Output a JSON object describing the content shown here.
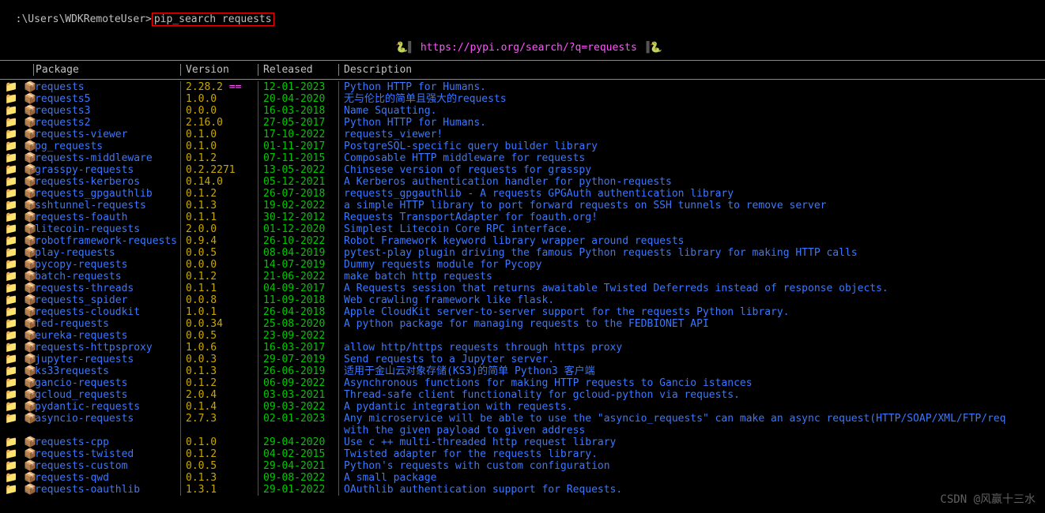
{
  "prompt": {
    "path": ":\\Users\\WDKRemoteUser>",
    "command": "pip_search requests"
  },
  "url_line": {
    "left": "🐍▌",
    "url": "https://pypi.org/search/?q=requests",
    "right": "▐🐍"
  },
  "headers": {
    "package": "Package",
    "version": "Version",
    "released": "Released",
    "description": "Description"
  },
  "rows": [
    {
      "pkg": "requests",
      "ver": "2.28.2 ==",
      "rel": "12-01-2023",
      "desc": "Python HTTP for Humans."
    },
    {
      "pkg": "requests5",
      "ver": "1.0.0",
      "rel": "20-04-2020",
      "desc": "无与伦比的简单且强大的requests"
    },
    {
      "pkg": "requests3",
      "ver": "0.0.0",
      "rel": "16-03-2018",
      "desc": "Name Squatting."
    },
    {
      "pkg": "requests2",
      "ver": "2.16.0",
      "rel": "27-05-2017",
      "desc": "Python HTTP for Humans."
    },
    {
      "pkg": "requests-viewer",
      "ver": "0.1.0",
      "rel": "17-10-2022",
      "desc": "requests_viewer!"
    },
    {
      "pkg": "pg_requests",
      "ver": "0.1.0",
      "rel": "01-11-2017",
      "desc": "PostgreSQL-specific query builder library"
    },
    {
      "pkg": "requests-middleware",
      "ver": "0.1.2",
      "rel": "07-11-2015",
      "desc": "Composable HTTP middleware for requests"
    },
    {
      "pkg": "grasspy-requests",
      "ver": "0.2.2271",
      "rel": "13-05-2022",
      "desc": "Chinsese version of requests for grasspy"
    },
    {
      "pkg": "requests-kerberos",
      "ver": "0.14.0",
      "rel": "05-12-2021",
      "desc": "A Kerberos authentication handler for python-requests"
    },
    {
      "pkg": "requests_gpgauthlib",
      "ver": "0.1.2",
      "rel": "26-07-2018",
      "desc": "requests_gpgauthlib - A requests GPGAuth authentication library"
    },
    {
      "pkg": "sshtunnel-requests",
      "ver": "0.1.3",
      "rel": "19-02-2022",
      "desc": "a simple HTTP library to port forward requests on SSH tunnels to remove server"
    },
    {
      "pkg": "requests-foauth",
      "ver": "0.1.1",
      "rel": "30-12-2012",
      "desc": "Requests TransportAdapter for foauth.org!"
    },
    {
      "pkg": "litecoin-requests",
      "ver": "2.0.0",
      "rel": "01-12-2020",
      "desc": "Simplest Litecoin Core RPC interface."
    },
    {
      "pkg": "robotframework-requests",
      "ver": "0.9.4",
      "rel": "26-10-2022",
      "desc": "Robot Framework keyword library wrapper around requests"
    },
    {
      "pkg": "play-requests",
      "ver": "0.0.5",
      "rel": "08-04-2019",
      "desc": "pytest-play plugin driving the famous Python requests library for making HTTP calls"
    },
    {
      "pkg": "pycopy-requests",
      "ver": "0.0.0",
      "rel": "14-07-2019",
      "desc": "Dummy requests module for Pycopy"
    },
    {
      "pkg": "batch-requests",
      "ver": "0.1.2",
      "rel": "21-06-2022",
      "desc": "make batch http requests"
    },
    {
      "pkg": "requests-threads",
      "ver": "0.1.1",
      "rel": "04-09-2017",
      "desc": "A Requests session that returns awaitable Twisted Deferreds instead of response objects."
    },
    {
      "pkg": "requests_spider",
      "ver": "0.0.8",
      "rel": "11-09-2018",
      "desc": "Web crawling framework like flask."
    },
    {
      "pkg": "requests-cloudkit",
      "ver": "1.0.1",
      "rel": "26-04-2018",
      "desc": "Apple CloudKit server-to-server support for the requests Python library."
    },
    {
      "pkg": "fed-requests",
      "ver": "0.0.34",
      "rel": "25-08-2020",
      "desc": "A python package for managing requests to the FEDBIONET API"
    },
    {
      "pkg": "eureka-requests",
      "ver": "0.0.5",
      "rel": "23-09-2022",
      "desc": ""
    },
    {
      "pkg": "requests-httpsproxy",
      "ver": "1.0.6",
      "rel": "16-03-2017",
      "desc": "allow http/https requests through https proxy"
    },
    {
      "pkg": "jupyter-requests",
      "ver": "0.0.3",
      "rel": "29-07-2019",
      "desc": "Send requests to a Jupyter server."
    },
    {
      "pkg": "ks33requests",
      "ver": "0.1.3",
      "rel": "26-06-2019",
      "desc": "适用于金山云对象存储(KS3)的简单 Python3 客户端"
    },
    {
      "pkg": "gancio-requests",
      "ver": "0.1.2",
      "rel": "06-09-2022",
      "desc": "Asynchronous functions for making HTTP requests to Gancio istances"
    },
    {
      "pkg": "gcloud_requests",
      "ver": "2.0.4",
      "rel": "03-03-2021",
      "desc": "Thread-safe client functionality for gcloud-python via requests."
    },
    {
      "pkg": "pydantic-requests",
      "ver": "0.1.4",
      "rel": "09-03-2022",
      "desc": "A pydantic integration with requests."
    },
    {
      "pkg": "asyncio-requests",
      "ver": "2.7.3",
      "rel": "02-01-2023",
      "desc": "Any microservice will be able to use the \"asyncio_requests\" can make an async request(HTTP/SOAP/XML/FTP/req",
      "cont": "with the given payload to given address"
    },
    {
      "pkg": "requests-cpp",
      "ver": "0.1.0",
      "rel": "29-04-2020",
      "desc": "Use c ++ multi-threaded http request library"
    },
    {
      "pkg": "requests-twisted",
      "ver": "0.1.2",
      "rel": "04-02-2015",
      "desc": "Twisted adapter for the requests library."
    },
    {
      "pkg": "requests-custom",
      "ver": "0.0.5",
      "rel": "29-04-2021",
      "desc": "Python's requests with custom configuration"
    },
    {
      "pkg": "requests-qwd",
      "ver": "0.1.3",
      "rel": "09-08-2022",
      "desc": "A small package"
    },
    {
      "pkg": "requests-oauthlib",
      "ver": "1.3.1",
      "rel": "29-01-2022",
      "desc": "OAuthlib authentication support for Requests."
    }
  ],
  "icon_cell": "📁 📦",
  "watermark": "CSDN @风赢十三水"
}
